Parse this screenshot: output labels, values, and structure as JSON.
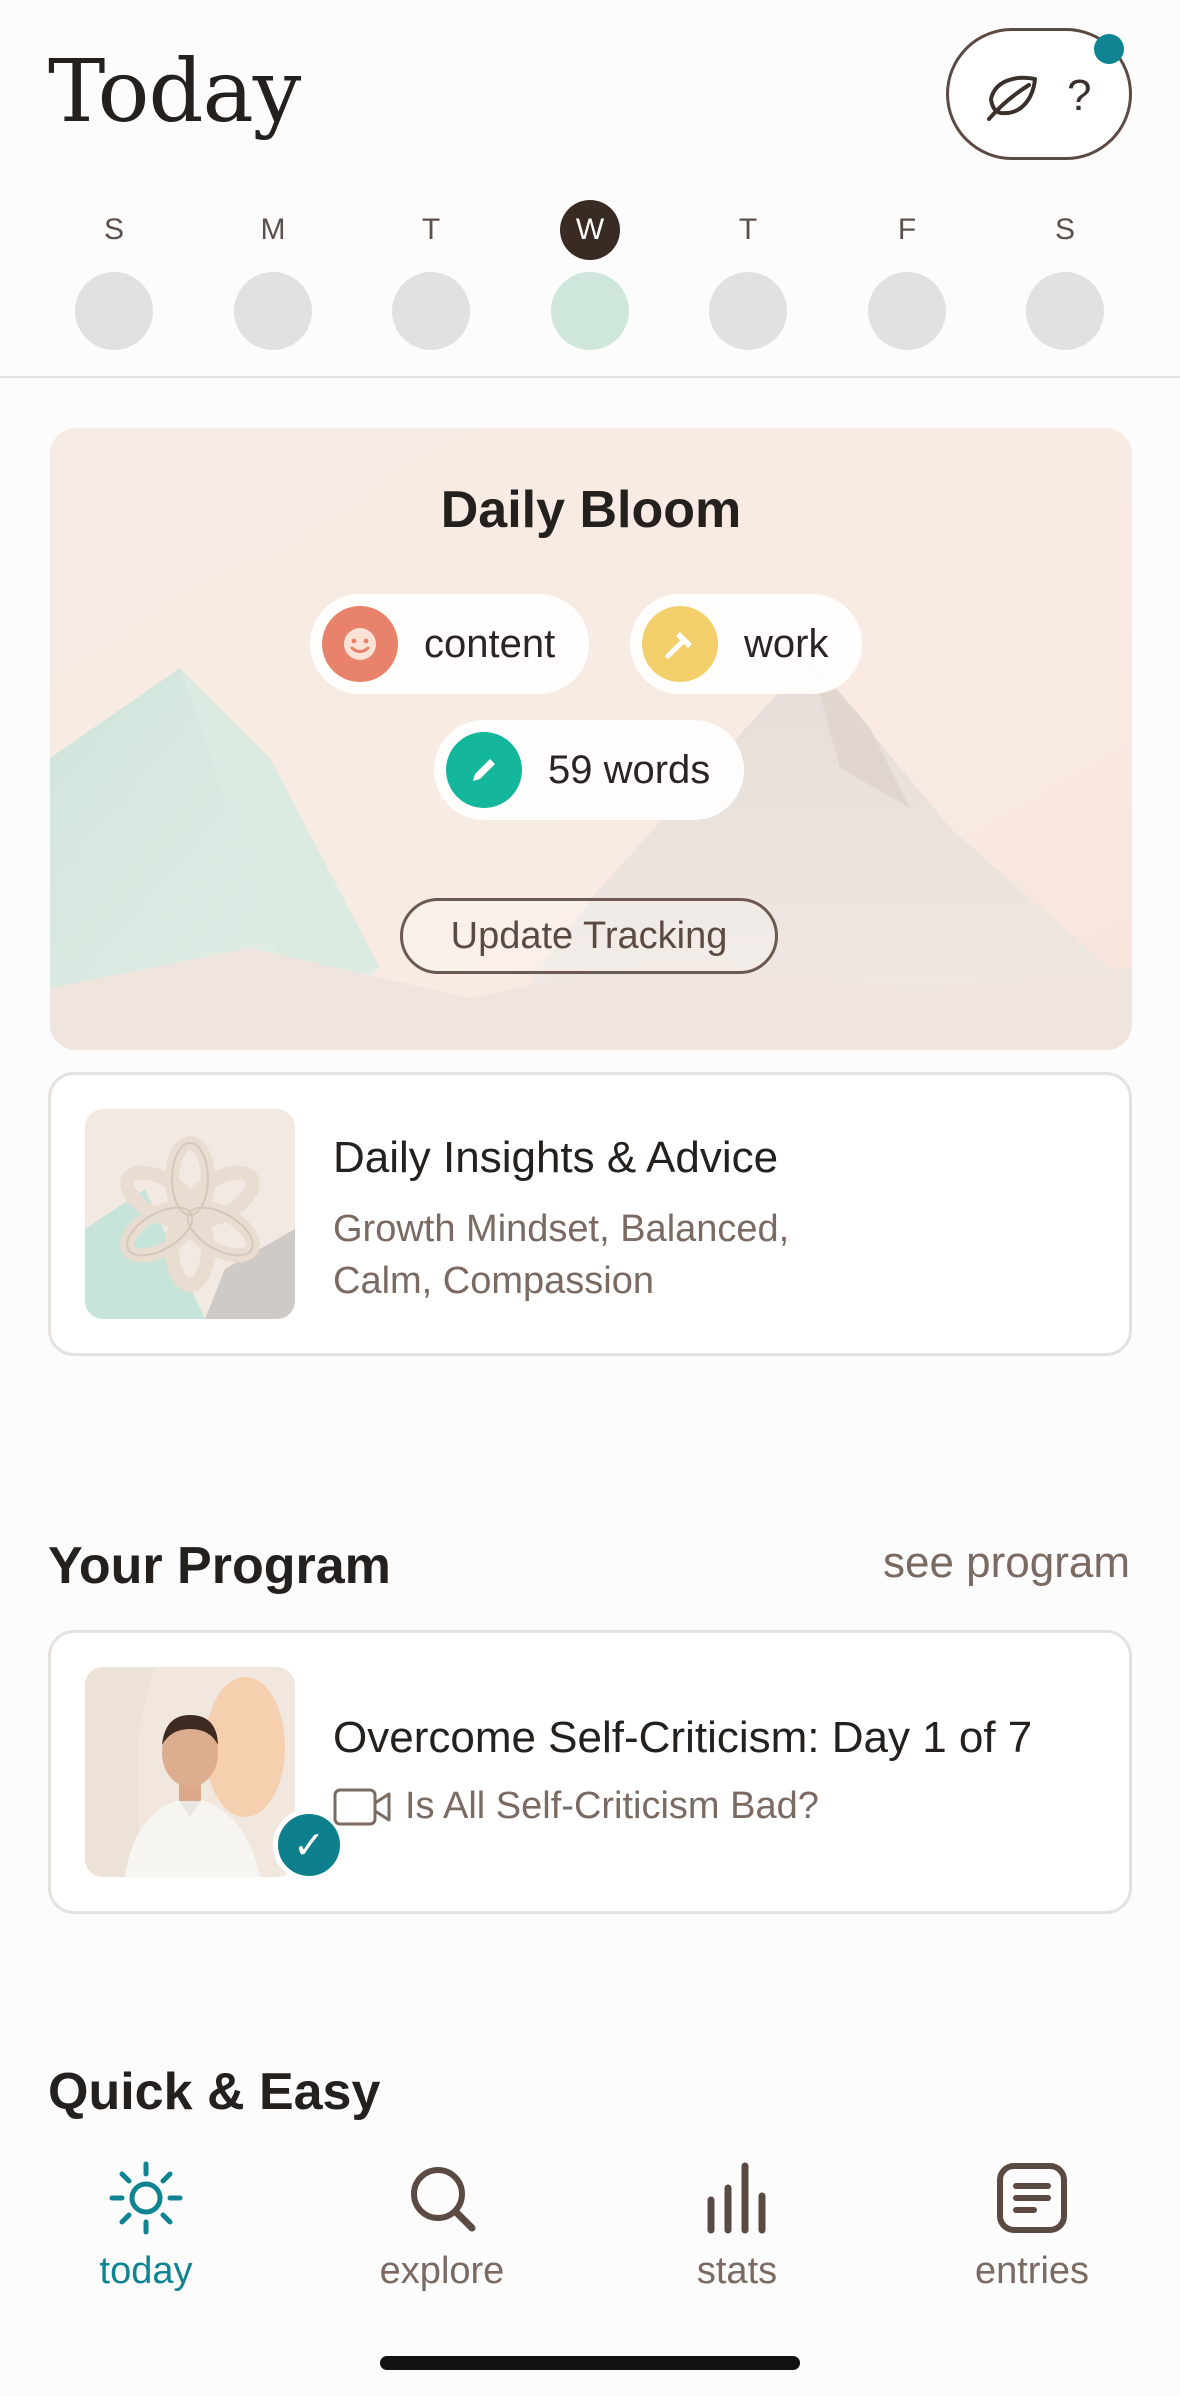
{
  "header": {
    "title": "Today",
    "coach_question": "?",
    "week": [
      {
        "letter": "S",
        "is_today": false
      },
      {
        "letter": "M",
        "is_today": false
      },
      {
        "letter": "T",
        "is_today": false
      },
      {
        "letter": "W",
        "is_today": true
      },
      {
        "letter": "T",
        "is_today": false
      },
      {
        "letter": "F",
        "is_today": false
      },
      {
        "letter": "S",
        "is_today": false
      }
    ]
  },
  "daily_bloom": {
    "title": "Daily Bloom",
    "mood": "content",
    "activity": "work",
    "words": "59 words",
    "update_button": "Update Tracking"
  },
  "insights": {
    "title": "Daily Insights & Advice",
    "subtitle": "Growth Mindset, Balanced, Calm, Compassion"
  },
  "program": {
    "section_title": "Your Program",
    "see_link": "see program",
    "title": "Overcome Self-Criticism: Day 1 of 7",
    "lesson": "Is All Self-Criticism Bad?"
  },
  "quick": {
    "section_title": "Quick & Easy"
  },
  "nav": {
    "today": "today",
    "explore": "explore",
    "stats": "stats",
    "entries": "entries"
  },
  "colors": {
    "accent": "#0e8391",
    "today_circle": "#cfe7da",
    "mood_icon": "#e8826a",
    "activity_icon": "#f3cf6b",
    "words_icon": "#14b79c"
  }
}
